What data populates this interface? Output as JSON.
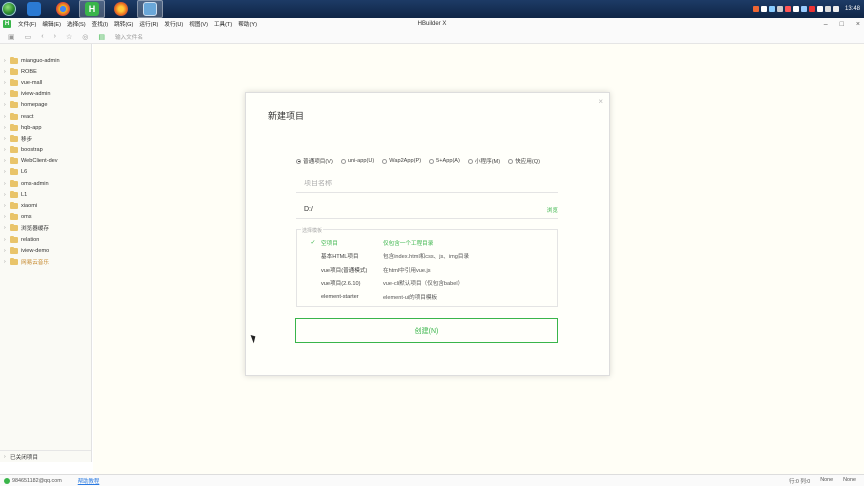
{
  "taskbar": {
    "apps": [
      {
        "name": "vscode-icon",
        "color": "#2b7ad3"
      },
      {
        "name": "chrome-icon",
        "color": "#f3b51b"
      },
      {
        "name": "hbuilder-icon",
        "color": "#39b54a",
        "label": "H"
      },
      {
        "name": "firefox-icon",
        "color": "#e86a1e"
      },
      {
        "name": "monitor-icon",
        "color": "#6aa7d8"
      }
    ],
    "time": "13:48"
  },
  "app": {
    "title": "HBuilder X",
    "menu": [
      "文件(F)",
      "编辑(E)",
      "选择(S)",
      "查找(I)",
      "跳转(G)",
      "运行(R)",
      "发行(U)",
      "视图(V)",
      "工具(T)",
      "帮助(Y)"
    ],
    "address_placeholder": "输入文件名"
  },
  "sidebar": {
    "items": [
      {
        "label": "mianguo-admin"
      },
      {
        "label": "ROBE"
      },
      {
        "label": "vue-mall"
      },
      {
        "label": "iview-admin"
      },
      {
        "label": "homepage"
      },
      {
        "label": "react"
      },
      {
        "label": "hqb-app"
      },
      {
        "label": "移步"
      },
      {
        "label": "boostrap"
      },
      {
        "label": "WebClient-dev"
      },
      {
        "label": "L6"
      },
      {
        "label": "oms-admin"
      },
      {
        "label": "L1"
      },
      {
        "label": "xiaomi"
      },
      {
        "label": "oms"
      },
      {
        "label": "浏览器缓存"
      },
      {
        "label": "relation"
      },
      {
        "label": "iview-demo"
      },
      {
        "label": "网易云音乐",
        "warn": true
      }
    ],
    "footer": "已关闭项目"
  },
  "dialog": {
    "title": "新建项目",
    "close": "×",
    "radios": [
      {
        "label": "普通项目(V)",
        "checked": true
      },
      {
        "label": "uni-app(U)",
        "checked": false
      },
      {
        "label": "Wap2App(P)",
        "checked": false
      },
      {
        "label": "5+App(A)",
        "checked": false
      },
      {
        "label": "小程序(M)",
        "checked": false
      },
      {
        "label": "快应用(Q)",
        "checked": false
      }
    ],
    "name_placeholder": "项目名称",
    "path_value": "D:/",
    "browse": "浏览",
    "template_legend": "选择模板",
    "templates": [
      {
        "name": "空项目",
        "desc": "仅包含一个工程目录",
        "selected": true
      },
      {
        "name": "基本HTML项目",
        "desc": "包含index.html和css、js、img目录",
        "selected": false
      },
      {
        "name": "vue项目(普通模式)",
        "desc": "在html中引用vue.js",
        "selected": false
      },
      {
        "name": "vue项目(2.6.10)",
        "desc": "vue-cli默认项目（仅包含babel）",
        "selected": false
      },
      {
        "name": "element-starter",
        "desc": "element-ui的项目模板",
        "selected": false
      }
    ],
    "create_button": "创建(N)"
  },
  "statusbar": {
    "user": "984651182@qq.com",
    "help": "帮助教程",
    "position": "行:0  列:0",
    "encoding": "None",
    "syntax": "None"
  },
  "colors": {
    "accent": "#39b54a",
    "taskbar": "#1d3b66"
  }
}
